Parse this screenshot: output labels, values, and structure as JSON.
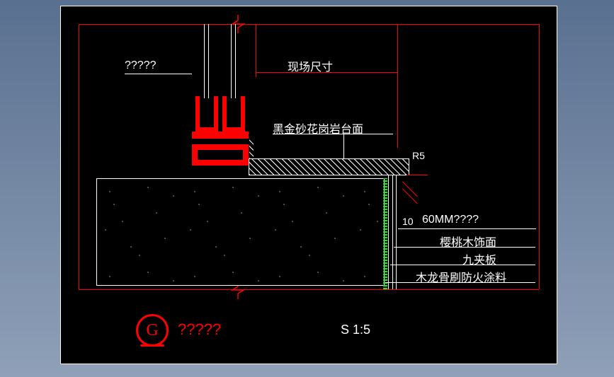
{
  "labels": {
    "unknown_top": "?????",
    "field_dim": "现场尺寸",
    "granite": "黑金砂花岗岩台面",
    "radius": "R5",
    "dim60": "60MM????",
    "dim10": "10",
    "cherry": "樱桃木饰面",
    "plywood": "九夹板",
    "firepaint": "木龙骨刷防火涂料"
  },
  "titleblock": {
    "bubble": "G",
    "title": "?????",
    "scale": "S 1:5"
  },
  "chart_data": {
    "type": "table",
    "description": "Architectural section detail, scale 1:5, reference bubble G",
    "elements": [
      {
        "name": "现场尺寸",
        "meaning": "field-measured dimension span"
      },
      {
        "name": "黑金砂花岗岩台面",
        "meaning": "Black Galaxy granite countertop"
      },
      {
        "name": "R5",
        "meaning": "5mm edge radius"
      },
      {
        "name": "10",
        "meaning": "reveal / gap 10"
      },
      {
        "name": "60MM????",
        "meaning": "60mm layer/offset (label partially unreadable)"
      },
      {
        "name": "樱桃木饰面",
        "meaning": "cherry wood veneer finish"
      },
      {
        "name": "九夹板",
        "meaning": "9-ply plywood"
      },
      {
        "name": "木龙骨刷防火涂料",
        "meaning": "timber battens with fire-retardant paint"
      },
      {
        "name": "?????",
        "meaning": "unreadable callout (top-left, attached to glazing/mullion)"
      }
    ],
    "scale": "1:5",
    "reference": "G"
  }
}
